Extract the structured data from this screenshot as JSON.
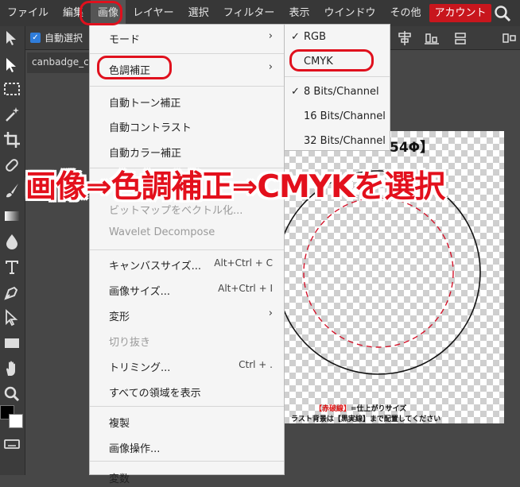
{
  "menubar": {
    "items": [
      "ファイル",
      "編集",
      "画像",
      "レイヤー",
      "選択",
      "フィルター",
      "表示",
      "ウインドウ",
      "その他"
    ],
    "account": "アカウント"
  },
  "options": {
    "auto_select": "自動選択"
  },
  "document": {
    "tab": "canbadge_c"
  },
  "image_menu": {
    "mode": "モード",
    "adjust": "色調補正",
    "auto_tone": "自動トーン補正",
    "auto_contrast": "自動コントラスト",
    "auto_color": "自動カラー補正",
    "bitmap": "ビットマップをベクトル化...",
    "wavelet": "Wavelet Decompose",
    "canvas_size": {
      "label": "キャンバスサイズ...",
      "shortcut": "Alt+Ctrl + C"
    },
    "image_size": {
      "label": "画像サイズ...",
      "shortcut": "Alt+Ctrl + I"
    },
    "transform": "変形",
    "crop": "切り抜き",
    "trim": {
      "label": "トリミング...",
      "shortcut": "Ctrl + ."
    },
    "reveal_all": "すべての領域を表示",
    "duplicate": "複製",
    "image_ops": "画像操作...",
    "last": "変数"
  },
  "mode_menu": {
    "rgb": "RGB",
    "cmyk": "CMYK",
    "bits8": "8 Bits/Channel",
    "bits16": "16 Bits/Channel",
    "bits32": "32 Bits/Channel",
    "check": "✓"
  },
  "canvas": {
    "heading": "54Φ】",
    "note_red": "【赤破線】",
    "note_rest": "=仕上がりサイズ",
    "note2": "ラスト背景は【黒実線】まで配置してください"
  },
  "banner": "画像⇒色調補正⇒CMYKを選択",
  "colors": {
    "accent_red": "#e0101d",
    "account_bg": "#c8161d",
    "menu_bg": "#f5f5f5"
  }
}
